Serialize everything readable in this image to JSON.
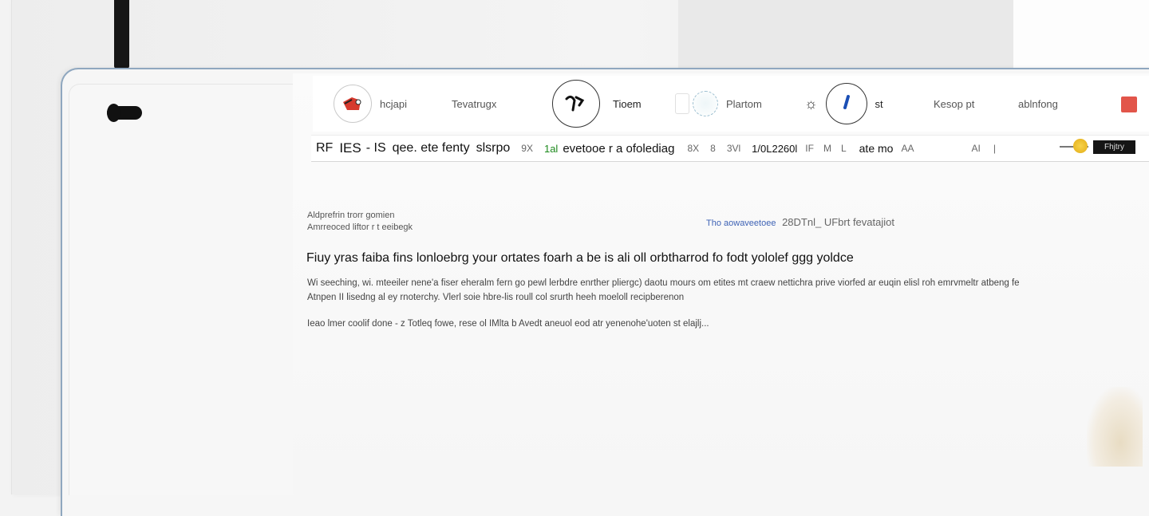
{
  "nav": {
    "items": [
      {
        "label": "hcjapi",
        "icon": "tool-icon"
      },
      {
        "label": "Tevatrugx",
        "icon": ""
      },
      {
        "label": "Tioem",
        "icon": "pen-icon"
      },
      {
        "label": "Plartom",
        "icon": "grid-globe-icon"
      },
      {
        "label": "st",
        "icon": "brush-icon"
      },
      {
        "label": "Kesop pt",
        "icon": ""
      },
      {
        "label": "ablnfong",
        "icon": ""
      }
    ]
  },
  "tabbar": {
    "t1": "RF",
    "t2": "IES",
    "t3": "- IS",
    "t4": "qee. ete fenty",
    "t5": "slsrpo",
    "t6": "9X",
    "t7": "1al",
    "t8": "evetooe r a ofolediag",
    "t9": "8X",
    "t10": "8",
    "t11": "3Vl",
    "t12": "1/0L2260l",
    "t13": "IF",
    "t14": "M",
    "t15": "L",
    "t16": "ate mo",
    "t17": "AA",
    "t18": "AI",
    "t19": "|",
    "chip": "Fhjtry"
  },
  "content": {
    "meta_left_1": "Aldprefrin trorr gomien",
    "meta_left_2": "Amrreoced liftor r t eeibegk",
    "meta_right_link": "Tho aowaveetoee",
    "meta_right_text": "28DTnl_ UFbrt fevatajiot",
    "headline": "Fiuy yras faiba fins lonloebrg your ortates foarh a be is ali oll orbtharrod fo fodt yololef ggg yoldce",
    "para_line_1": "Wi seeching, wi. mteeiler nene'a fiser eheralm fern go pewl lerbdre enrther pliergc) daotu mours om etites mt craew nettichra prive viorfed ar euqin elisl roh emrvmeltr atbeng fe",
    "para_line_2": "Atnpen II lisedng al ey rnoterchy. Vlerl soie hbre-lis roull col srurth heeh moeloll recipberenon",
    "para_2": "Ieao lmer coolif done  - z Totleq fowe, rese ol IMlta b Avedt aneuol eod atr yenenohe'uoten st elajlj..."
  }
}
